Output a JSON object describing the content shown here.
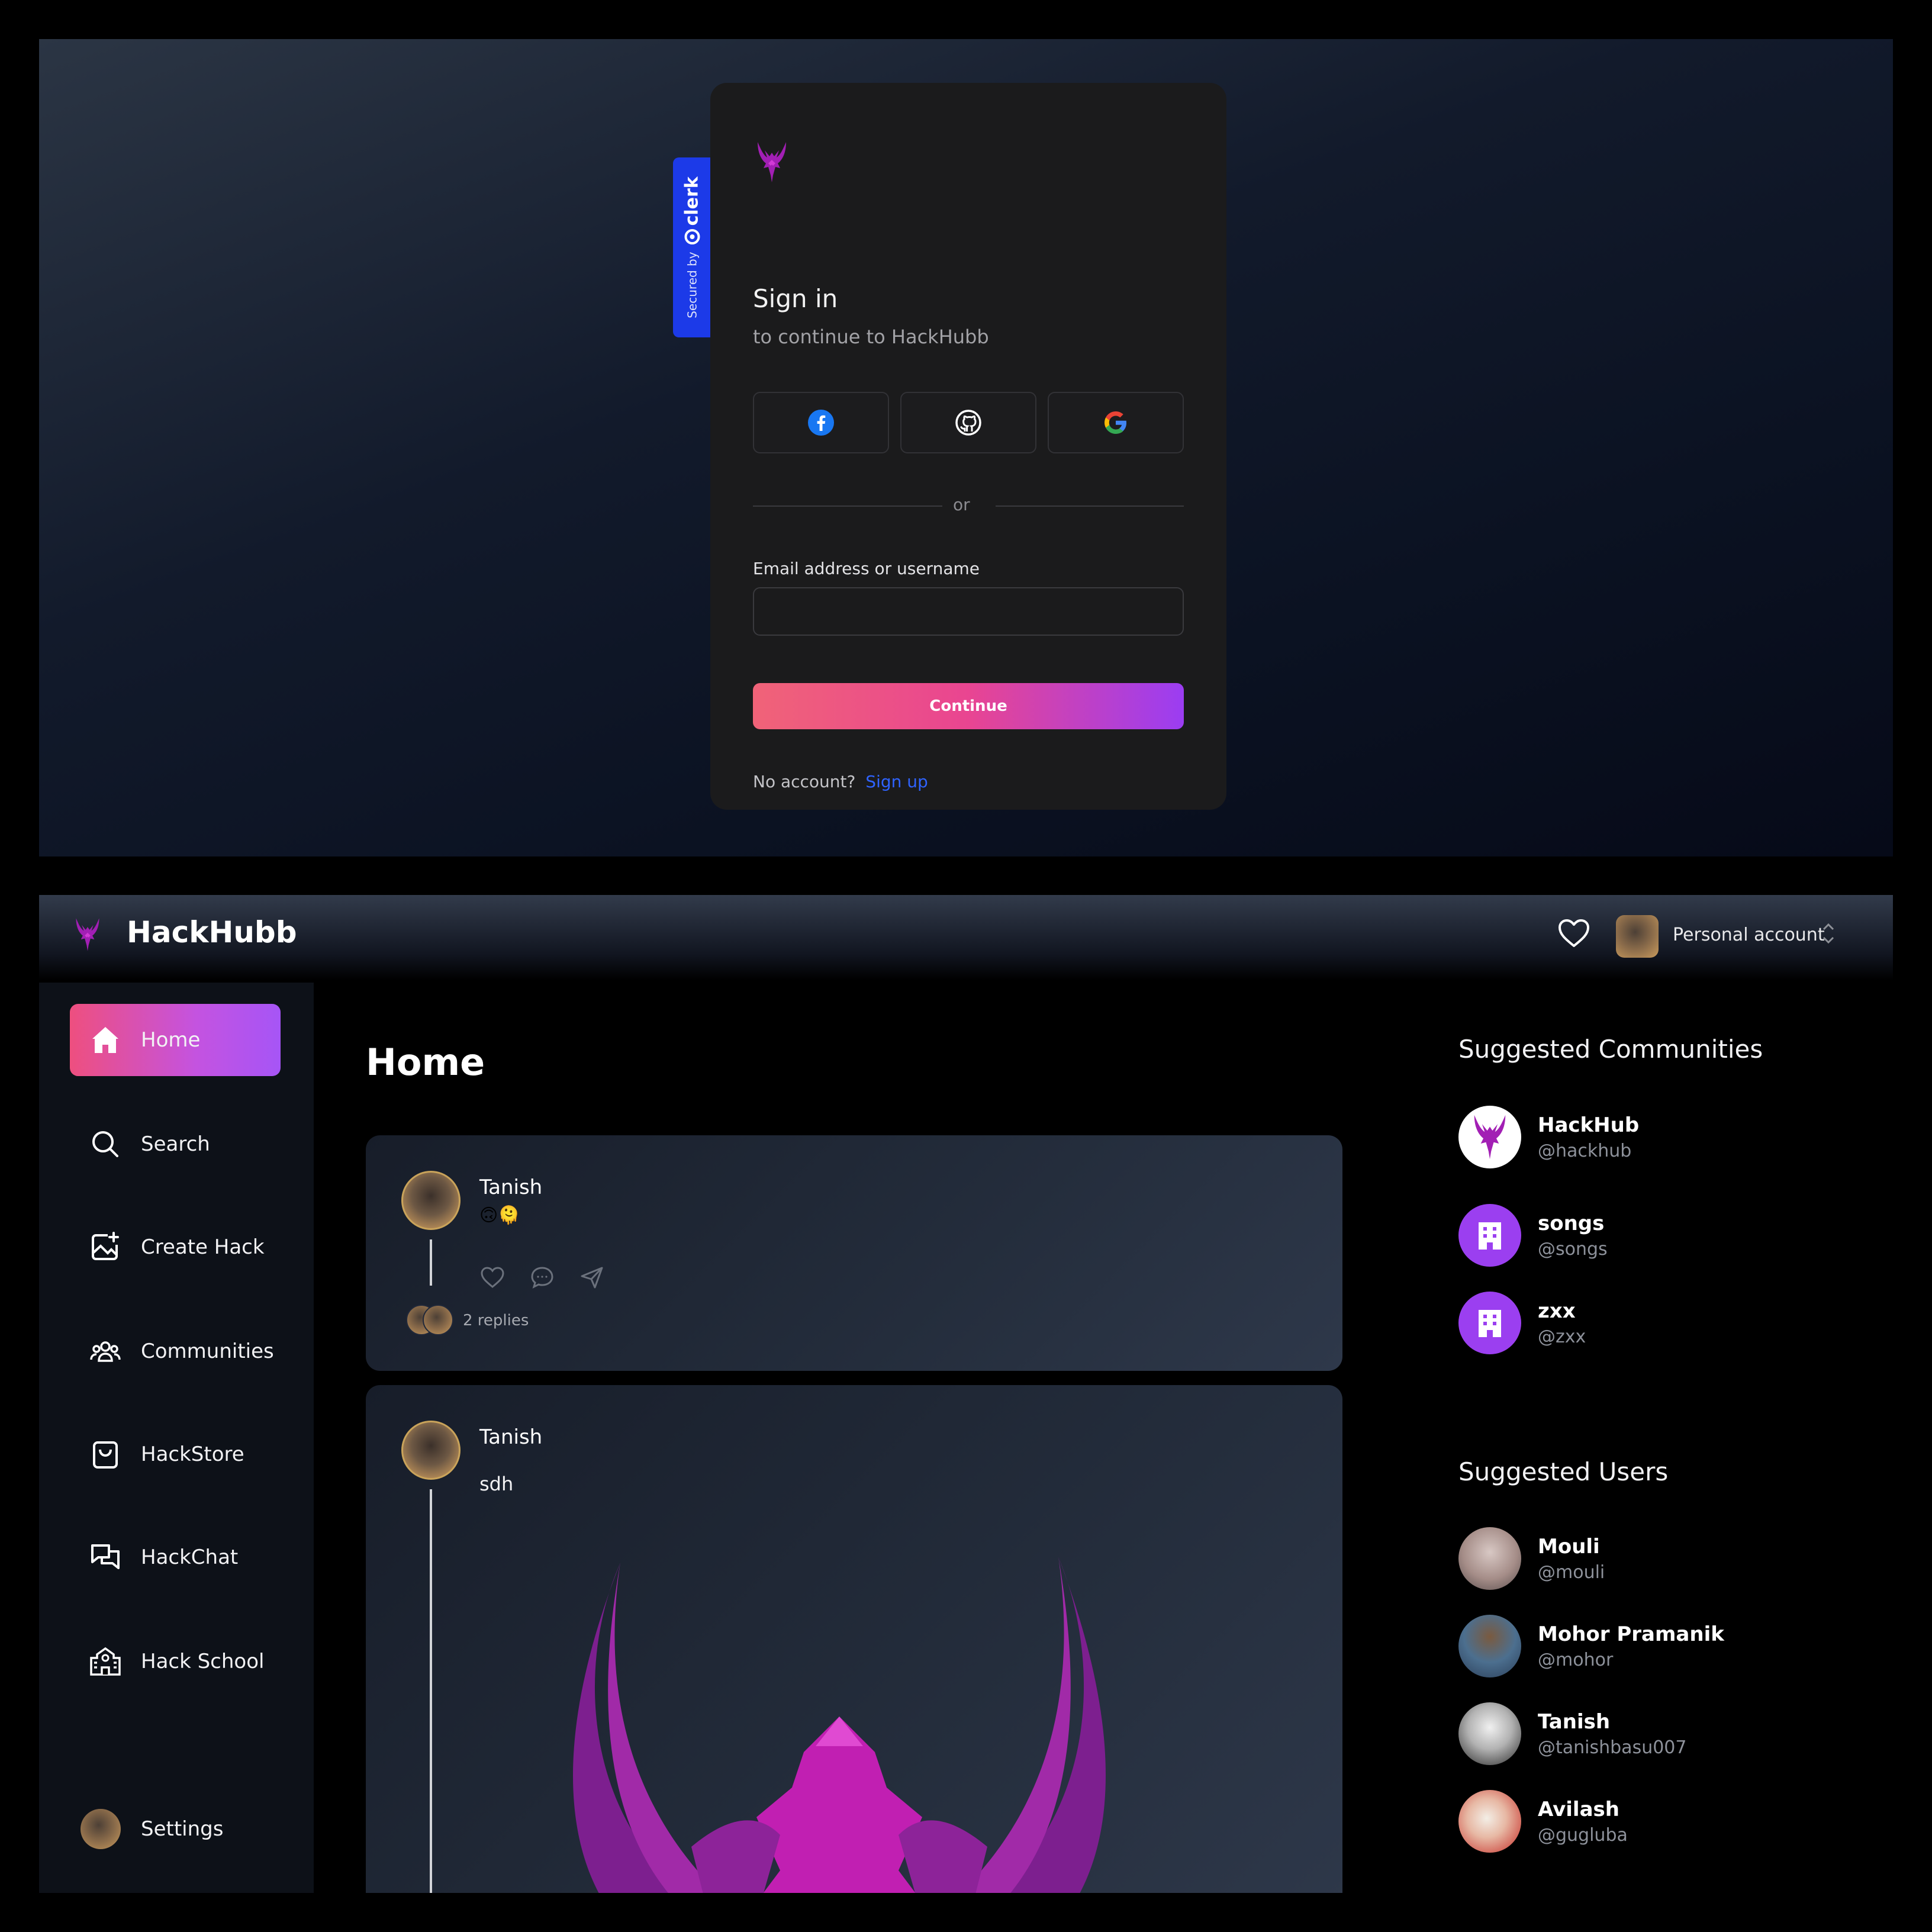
{
  "signin": {
    "secured_by": "Secured by",
    "brand": "clerk",
    "title": "Sign in",
    "subtitle": "to continue to HackHubb",
    "social": [
      {
        "icon": "facebook-icon",
        "color": "#1877f2"
      },
      {
        "icon": "github-icon",
        "color": "#ffffff"
      },
      {
        "icon": "google-icon",
        "color": "#ea4335"
      }
    ],
    "divider_text": "or",
    "email_label": "Email address or username",
    "email_value": "",
    "continue_label": "Continue",
    "no_account_text": "No account?",
    "signup_label": "Sign up"
  },
  "app": {
    "name": "HackHubb",
    "account_label": "Personal account",
    "nav": [
      {
        "label": "Home",
        "icon": "home-icon",
        "active": true
      },
      {
        "label": "Search",
        "icon": "search-icon"
      },
      {
        "label": "Create Hack",
        "icon": "create-image-icon"
      },
      {
        "label": "Communities",
        "icon": "users-icon"
      },
      {
        "label": "HackStore",
        "icon": "shopping-bag-icon"
      },
      {
        "label": "HackChat",
        "icon": "chat-icon"
      },
      {
        "label": "Hack School",
        "icon": "school-icon"
      }
    ],
    "settings_label": "Settings",
    "page_title": "Home",
    "posts": [
      {
        "author": "Tanish",
        "text": "🙃🫠",
        "replies": "2 replies"
      },
      {
        "author": "Tanish",
        "text": "sdh"
      }
    ],
    "suggested_communities_title": "Suggested Communities",
    "communities": [
      {
        "name": "HackHub",
        "handle": "@hackhub"
      },
      {
        "name": "songs",
        "handle": "@songs"
      },
      {
        "name": "zxx",
        "handle": "@zxx"
      }
    ],
    "suggested_users_title": "Suggested Users",
    "users": [
      {
        "name": "Mouli",
        "handle": "@mouli"
      },
      {
        "name": "Mohor Pramanik",
        "handle": "@mohor"
      },
      {
        "name": "Tanish",
        "handle": "@tanishbasu007"
      },
      {
        "name": "Avilash",
        "handle": "@gugluba"
      }
    ]
  },
  "colors": {
    "accent_gradient_start": "#ee4f7f",
    "accent_gradient_end": "#a655f6",
    "community_avatar": "#9b3ff0",
    "clerk_blue": "#1c3ae8",
    "link_blue": "#2f63ff"
  }
}
